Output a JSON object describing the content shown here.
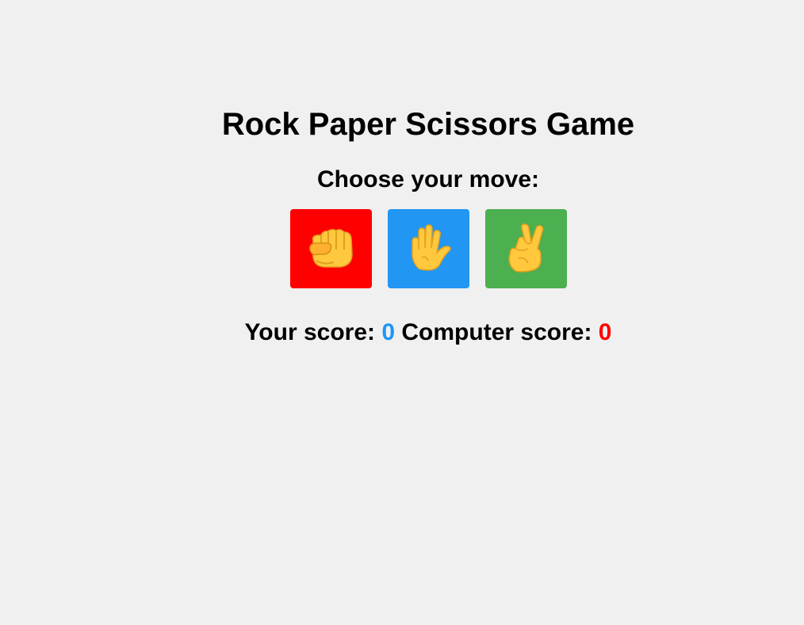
{
  "title": "Rock Paper Scissors Game",
  "prompt": "Choose your move:",
  "moves": [
    {
      "id": "rock",
      "icon": "fist-icon",
      "color": "#ff0000"
    },
    {
      "id": "paper",
      "icon": "open-hand-icon",
      "color": "#2196f3"
    },
    {
      "id": "scissors",
      "icon": "victory-hand-icon",
      "color": "#4caf50"
    }
  ],
  "scores": {
    "user_label": "Your score:",
    "user_value": "0",
    "user_color": "#2196f3",
    "computer_label": "Computer score:",
    "computer_value": "0",
    "computer_color": "#ff0000"
  }
}
